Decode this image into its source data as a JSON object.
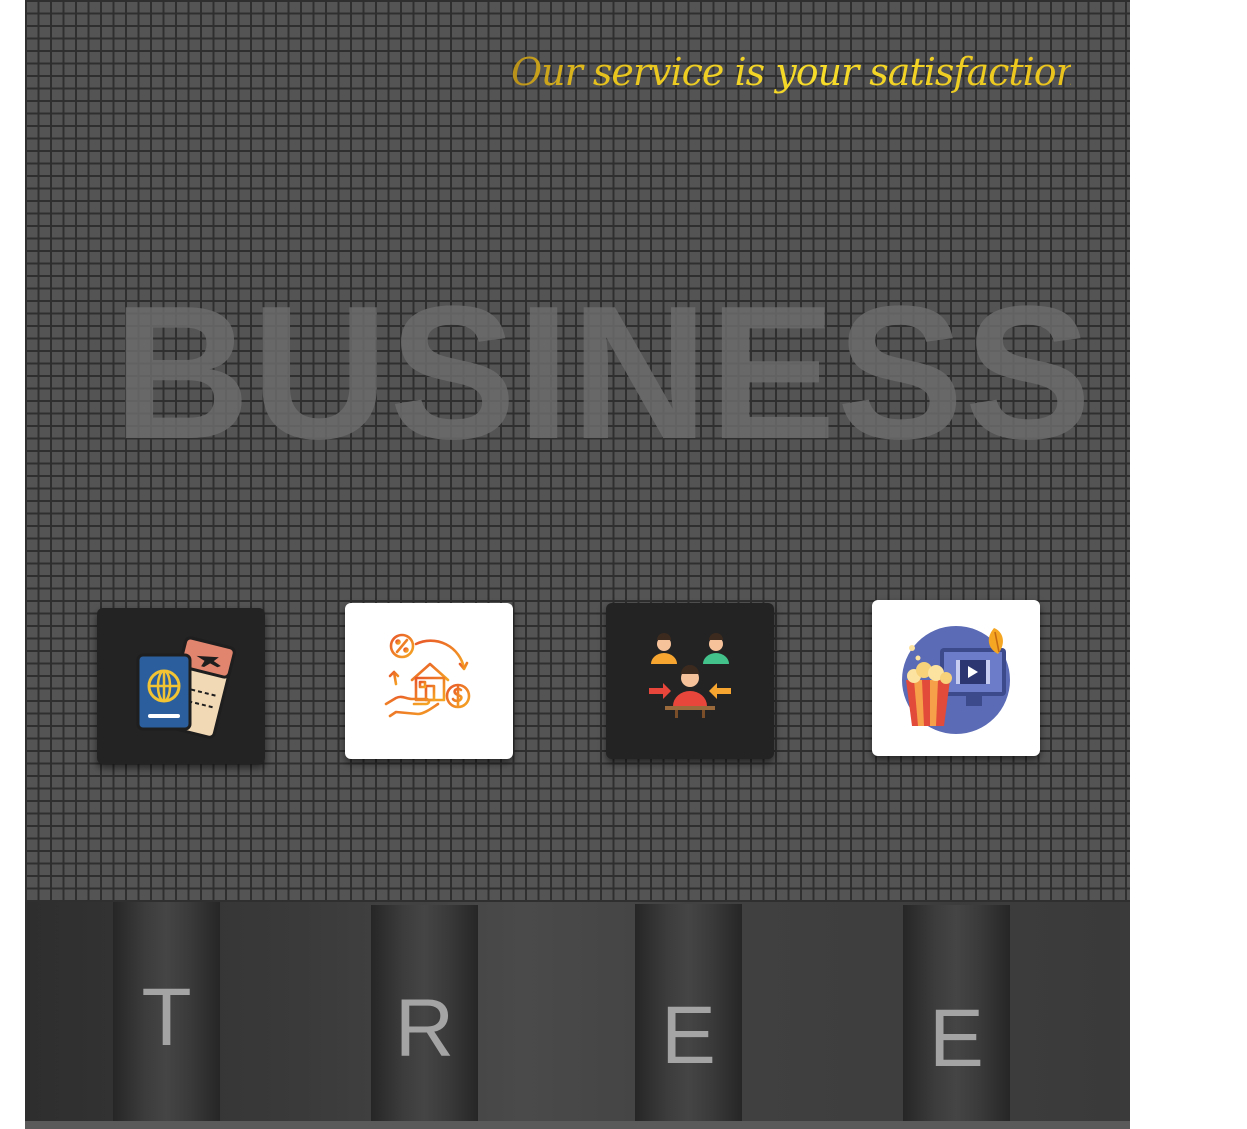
{
  "header": {
    "tagline": "Our service is your satisfaction!"
  },
  "hero": {
    "word": "BUSINESS"
  },
  "services": [
    {
      "icon": "passport-ticket-icon",
      "theme": "dark"
    },
    {
      "icon": "real-estate-finance-icon",
      "theme": "light"
    },
    {
      "icon": "team-meeting-icon",
      "theme": "dark"
    },
    {
      "icon": "movie-popcorn-icon",
      "theme": "light"
    }
  ],
  "footer": {
    "letters": [
      "T",
      "R",
      "E",
      "E"
    ]
  },
  "colors": {
    "tagline_gold": "#e6c11d",
    "grid_bg": "#545454",
    "grid_line": "#2f2f2f",
    "hero_text": "#6c6c6c",
    "footer_letter": "#a4a4a4"
  }
}
